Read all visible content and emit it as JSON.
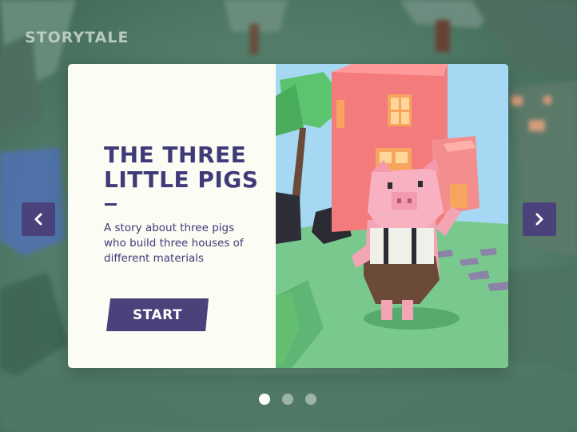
{
  "app": {
    "brand": "STORYTALE"
  },
  "story": {
    "title": "THE THREE LITTLE PIGS",
    "dash": "–",
    "description": "A story about three pigs who build three houses of different materials",
    "start_label": "START"
  },
  "navigation": {
    "prev_icon": "chevron-left-icon",
    "next_icon": "chevron-right-icon"
  },
  "pagination": {
    "total": 3,
    "active_index": 0
  },
  "colors": {
    "primary": "#4a427a",
    "title_text": "#3f3a78",
    "card_bg": "#fbfcf4",
    "dot_inactive": "#9db5a9",
    "dot_active": "#ffffff"
  }
}
